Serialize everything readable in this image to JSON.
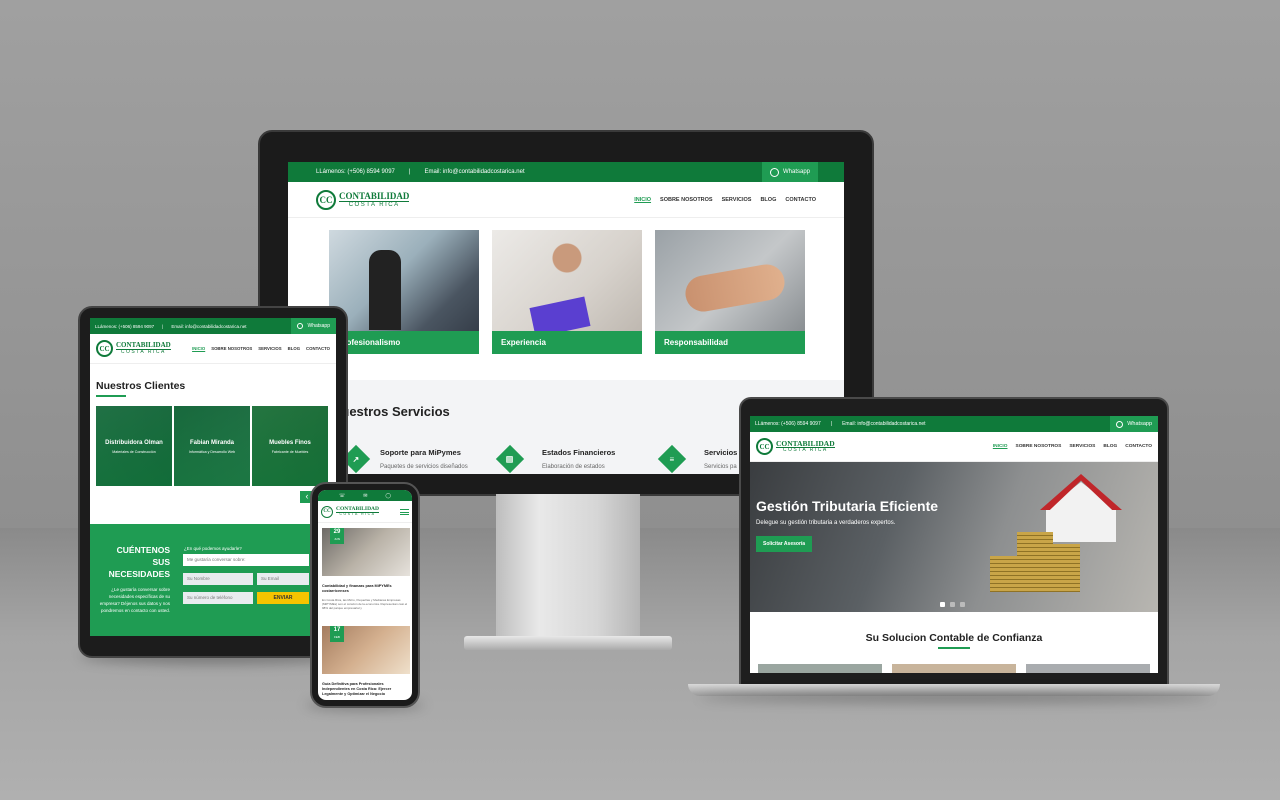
{
  "brand": {
    "name": "CONTABILIDAD",
    "subname": "COSTA RICA",
    "mark": "CC"
  },
  "topbar": {
    "phone": "LLámenos: (+506) 8594 9097",
    "sep": "|",
    "email": "Email: info@contabilidadcostarica.net",
    "whatsapp": "Whatsapp"
  },
  "nav": {
    "inicio": "INICIO",
    "sobre": "SOBRE NOSOTROS",
    "servicios": "SERVICIOS",
    "blog": "BLOG",
    "contacto": "CONTACTO"
  },
  "desktop": {
    "cards": [
      {
        "label": "Profesionalismo"
      },
      {
        "label": "Experiencia"
      },
      {
        "label": "Responsabilidad"
      }
    ],
    "services_title": "Nuestros Servicios",
    "services": [
      {
        "title": "Soporte para MiPymes",
        "desc": "Paquetes de servicios diseñados"
      },
      {
        "title": "Estados Financieros",
        "desc": "Elaboración de estados"
      },
      {
        "title": "Servicios",
        "desc": "Servicios pa"
      }
    ]
  },
  "tablet": {
    "clients_title": "Nuestros Clientes",
    "clients": [
      {
        "name": "Distribuidora Olman",
        "desc": "Materiales de Construcción"
      },
      {
        "name": "Fabian Miranda",
        "desc": "Informática y Desarrollo Web"
      },
      {
        "name": "Muebles Finos",
        "desc": "Fabricante de Muebles"
      }
    ],
    "cta_title": "CUÉNTENOS SUS NECESIDADES",
    "cta_text": "¿Le gustaría conversar sobre necesidades específicas de su empresa? Déjenos sus datos y nos pondremos en contacto con usted.",
    "form_label": "¿En qué podemos ayudarle?",
    "topic_placeholder": "Me gustaría conversar sobre:",
    "name_placeholder": "Su Nombre",
    "email_placeholder": "Su Email",
    "phone_placeholder": "Su número de teléfono",
    "send": "ENVIAR",
    "arrow_left": "‹"
  },
  "phone": {
    "posts": [
      {
        "day": "29",
        "month": "JUN",
        "title": "Contabilidad y finanzas para MiPYMEs costarricenses",
        "excerpt": "En Costa Rica, las Micro, Pequeñas y Medianas Empresas (MiPYMEs) son el corazón de la economía. Representan casi el 98% del parque empresarial y"
      },
      {
        "day": "17",
        "month": "FEB",
        "title": "Guía Definitiva para Profesionales Independientes en Costa Rica: Ejercer Legalmente y Optimizar el Negocio"
      }
    ]
  },
  "laptop": {
    "hero_title": "Gestión Tributaria Eficiente",
    "hero_sub": "Delegue su gestión tributaria a verdaderos expertos.",
    "hero_btn": "Solicitar Asesoría",
    "section_title": "Su Solucion Contable de Confianza"
  }
}
